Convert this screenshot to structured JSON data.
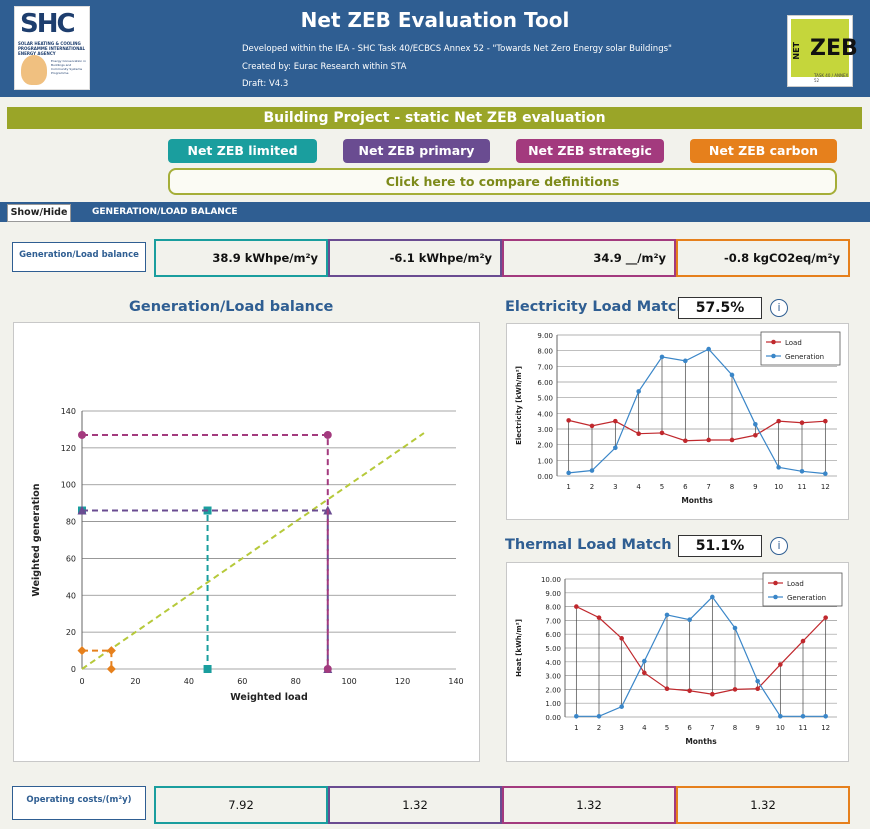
{
  "header": {
    "title": "Net ZEB Evaluation Tool",
    "line1": "Developed within the IEA - SHC Task 40/ECBCS Annex 52 - \"Towards Net Zero Energy solar Buildings\"",
    "line2": "Created by: Eurac Research within STA",
    "line3": "Draft: V4.3",
    "shc_logo_text": "SHC",
    "shc_logo_sub": "SOLAR HEATING & COOLING PROGRAMME INTERNATIONAL ENERGY AGENCY",
    "shc_logo_sub2": "Energy Conservation in Buildings and Community Systems Programme",
    "zeb_logo_net": "NET",
    "zeb_logo_zeb": "ZEB",
    "zeb_logo_task": "TASK 40 / ANNEX 52"
  },
  "project_title": "Building Project - static Net ZEB evaluation",
  "definitions": [
    {
      "label": "Net ZEB limited",
      "color": "#1a9e9e"
    },
    {
      "label": "Net ZEB primary",
      "color": "#6a4c91"
    },
    {
      "label": "Net ZEB strategic",
      "color": "#a33a7e"
    },
    {
      "label": "Net ZEB carbon",
      "color": "#e6801c"
    }
  ],
  "compare_label": "Click here to compare definitions",
  "section": {
    "toggle_label": "Show/Hide",
    "title": "GENERATION/LOAD BALANCE"
  },
  "balance": {
    "label": "Generation/Load balance",
    "values": [
      "38.9 kWhpe/m²y",
      "-6.1 kWhpe/m²y",
      "34.9 __/m²y",
      "-0.8 kgCO2eq/m²y"
    ]
  },
  "costs": {
    "label": "Operating costs/(m²y)",
    "values": [
      "7.92",
      "1.32",
      "1.32",
      "1.32"
    ]
  },
  "electricity_match": {
    "title": "Electricity Load Match",
    "value": "57.5%",
    "info": "i"
  },
  "thermal_match": {
    "title": "Thermal Load Match",
    "value": "51.1%",
    "info": "i"
  },
  "chart_data": [
    {
      "type": "scatter",
      "title": "Generation/Load balance",
      "xlabel": "Weighted load",
      "ylabel": "Weighted generation",
      "xlim": [
        0,
        140
      ],
      "ylim": [
        0,
        140
      ],
      "xticks": [
        0,
        20,
        40,
        60,
        80,
        100,
        120,
        140
      ],
      "yticks": [
        0,
        20,
        40,
        60,
        80,
        100,
        120,
        140
      ],
      "grid": true,
      "diagonal": {
        "x": [
          0,
          128
        ],
        "y": [
          0,
          128
        ],
        "color": "#b6c93a"
      },
      "series": [
        {
          "color": "#e6801c",
          "marker": "diamond",
          "points": [
            {
              "x": 11,
              "y": 10
            }
          ],
          "load": 11,
          "generation": 10
        },
        {
          "color": "#1a9e9e",
          "marker": "square",
          "points": [
            {
              "x": 47,
              "y": 86
            }
          ],
          "load": 47,
          "generation": 86
        },
        {
          "color": "#6a4c91",
          "marker": "triangle",
          "points": [
            {
              "x": 92,
              "y": 86
            }
          ],
          "load": 92,
          "generation": 86
        },
        {
          "color": "#a33a7e",
          "marker": "circle",
          "points": [
            {
              "x": 92,
              "y": 127
            }
          ],
          "load": 92,
          "generation": 127
        }
      ]
    },
    {
      "type": "line",
      "xlabel": "Months",
      "ylabel": "Electricity [kWh/m²]",
      "categories": [
        "1",
        "2",
        "3",
        "4",
        "5",
        "6",
        "7",
        "8",
        "9",
        "10",
        "11",
        "12"
      ],
      "ylim": [
        0,
        9
      ],
      "yticks": [
        "0.00",
        "1.00",
        "2.00",
        "3.00",
        "4.00",
        "5.00",
        "6.00",
        "7.00",
        "8.00",
        "9.00"
      ],
      "grid": true,
      "legend": "top-right",
      "series": [
        {
          "name": "Load",
          "color": "#c0282d",
          "values": [
            3.55,
            3.2,
            3.5,
            2.7,
            2.75,
            2.25,
            2.3,
            2.3,
            2.6,
            3.5,
            3.4,
            3.5
          ]
        },
        {
          "name": "Generation",
          "color": "#3a86c8",
          "values": [
            0.2,
            0.35,
            1.8,
            5.4,
            7.6,
            7.35,
            8.1,
            6.45,
            3.3,
            0.55,
            0.3,
            0.15
          ]
        }
      ]
    },
    {
      "type": "line",
      "xlabel": "Months",
      "ylabel": "Heat [kWh/m²]",
      "categories": [
        "1",
        "2",
        "3",
        "4",
        "5",
        "6",
        "7",
        "8",
        "9",
        "10",
        "11",
        "12"
      ],
      "ylim": [
        0,
        10
      ],
      "yticks": [
        "0.00",
        "1.00",
        "2.00",
        "3.00",
        "4.00",
        "5.00",
        "6.00",
        "7.00",
        "8.00",
        "9.00",
        "10.00"
      ],
      "grid": true,
      "legend": "top-right",
      "series": [
        {
          "name": "Load",
          "color": "#c0282d",
          "values": [
            8.0,
            7.2,
            5.7,
            3.2,
            2.05,
            1.9,
            1.65,
            2.0,
            2.05,
            3.8,
            5.5,
            7.2
          ]
        },
        {
          "name": "Generation",
          "color": "#3a86c8",
          "values": [
            0.05,
            0.05,
            0.75,
            4.05,
            7.4,
            7.05,
            8.7,
            6.45,
            2.6,
            0.05,
            0.05,
            0.05
          ]
        }
      ]
    }
  ]
}
